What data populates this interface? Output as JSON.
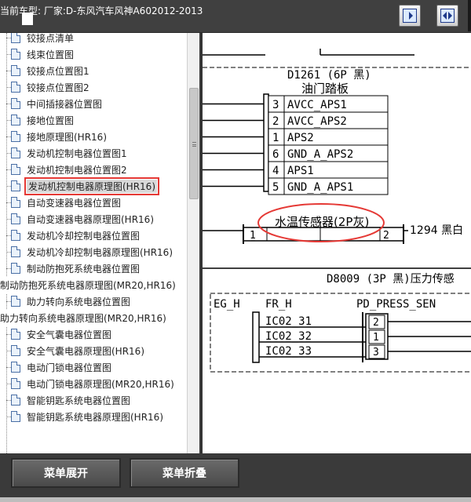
{
  "topbar": {
    "vehicle_label": "当前车型:   厂家:D-东风汽车风神A602012-2013"
  },
  "tree": {
    "items": [
      {
        "label": "铰接点清单",
        "level": 1,
        "selected": false
      },
      {
        "label": "线束位置图",
        "level": 1,
        "selected": false
      },
      {
        "label": "铰接点位置图1",
        "level": 1,
        "selected": false
      },
      {
        "label": "铰接点位置图2",
        "level": 1,
        "selected": false
      },
      {
        "label": "中间插接器位置图",
        "level": 1,
        "selected": false
      },
      {
        "label": "接地位置图",
        "level": 1,
        "selected": false
      },
      {
        "label": "接地原理图(HR16)",
        "level": 1,
        "selected": false
      },
      {
        "label": "发动机控制电器位置图1",
        "level": 1,
        "selected": false
      },
      {
        "label": "发动机控制电器位置图2",
        "level": 1,
        "selected": false
      },
      {
        "label": "发动机控制电器原理图(HR16)",
        "level": 1,
        "selected": true
      },
      {
        "label": "自动变速器电器位置图",
        "level": 1,
        "selected": false
      },
      {
        "label": "自动变速器电器原理图(HR16)",
        "level": 1,
        "selected": false
      },
      {
        "label": "发动机冷却控制电器位置图",
        "level": 1,
        "selected": false
      },
      {
        "label": "发动机冷却控制电器原理图(HR16)",
        "level": 1,
        "selected": false
      },
      {
        "label": "制动防抱死系统电器位置图",
        "level": 1,
        "selected": false
      },
      {
        "label": "制动防抱死系统电器原理图(MR20,HR16)",
        "level": 0,
        "selected": false
      },
      {
        "label": "助力转向系统电器位置图",
        "level": 1,
        "selected": false
      },
      {
        "label": "助力转向系统电器原理图(MR20,HR16)",
        "level": 0,
        "selected": false
      },
      {
        "label": "安全气囊电器位置图",
        "level": 1,
        "selected": false
      },
      {
        "label": "安全气囊电器原理图(HR16)",
        "level": 1,
        "selected": false
      },
      {
        "label": "电动门锁电器位置图",
        "level": 1,
        "selected": false
      },
      {
        "label": "电动门锁电器原理图(MR20,HR16)",
        "level": 1,
        "selected": false
      },
      {
        "label": "智能钥匙系统电器位置图",
        "level": 1,
        "selected": false
      },
      {
        "label": "智能钥匙系统电器原理图(HR16)",
        "level": 1,
        "selected": false
      }
    ]
  },
  "diagram": {
    "connector1_title": "D1261 (6P 黑)",
    "connector1_name": "油门踏板",
    "pins1": [
      {
        "num": "3",
        "name": "AVCC_APS1"
      },
      {
        "num": "2",
        "name": "AVCC_APS2"
      },
      {
        "num": "1",
        "name": "APS2"
      },
      {
        "num": "6",
        "name": "GND_A_APS2"
      },
      {
        "num": "4",
        "name": "APS1"
      },
      {
        "num": "5",
        "name": "GND_A_APS1"
      }
    ],
    "sensor_label": "水温传感器(2P灰)",
    "sensor_pin_left": "1",
    "sensor_pin_right": "2",
    "wire_label": "1294 黑白",
    "connector2_title": "D8009 (3P 黑)压力传感",
    "ecu_labels": [
      "EG_H",
      "FR_H",
      "PD_PRESS_SEN"
    ],
    "pins2": [
      {
        "ic": "IC02_31",
        "num": "2"
      },
      {
        "ic": "IC02_32",
        "num": "1"
      },
      {
        "ic": "IC02_33",
        "num": "3"
      }
    ]
  },
  "bottom": {
    "expand_label": "菜单展开",
    "collapse_label": "菜单折叠"
  },
  "colors": {
    "highlight": "#e53935",
    "selected_bg": "#d9d9d9",
    "toolbar_bg": "#404040"
  }
}
